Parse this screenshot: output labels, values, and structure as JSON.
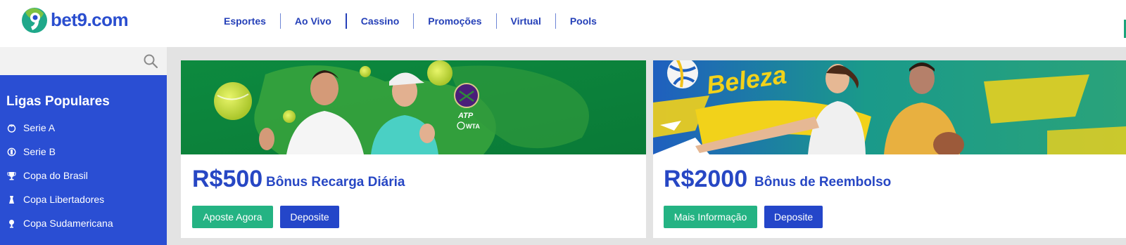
{
  "header": {
    "logo_text": "bet9.com",
    "nav": [
      {
        "label": "Esportes"
      },
      {
        "label": "Ao Vivo"
      },
      {
        "label": "Cassino"
      },
      {
        "label": "Promoções"
      },
      {
        "label": "Virtual"
      },
      {
        "label": "Pools"
      }
    ]
  },
  "sidebar": {
    "search_icon": "search-icon",
    "title": "Ligas Populares",
    "leagues": [
      {
        "label": "Serie A",
        "icon": "serie-a-icon"
      },
      {
        "label": "Serie B",
        "icon": "serie-b-icon"
      },
      {
        "label": "Copa do Brasil",
        "icon": "trophy-icon"
      },
      {
        "label": "Copa Libertadores",
        "icon": "libertadores-icon"
      },
      {
        "label": "Copa Sudamericana",
        "icon": "sudamericana-icon"
      }
    ]
  },
  "promos": [
    {
      "banner_text": [
        "ATP",
        "WTA"
      ],
      "amount": "R$500",
      "title": "Bônus Recarga Diária",
      "primary_button": "Aposte Agora",
      "secondary_button": "Deposite"
    },
    {
      "banner_text": [
        "Beleza"
      ],
      "amount": "R$2000",
      "title": "Bônus de Reembolso",
      "primary_button": "Mais Informação",
      "secondary_button": "Deposite"
    }
  ],
  "colors": {
    "brand_blue": "#2a4ed3",
    "brand_green": "#24b383",
    "logo_green": "#7dc242",
    "logo_teal": "#1fa88a"
  }
}
